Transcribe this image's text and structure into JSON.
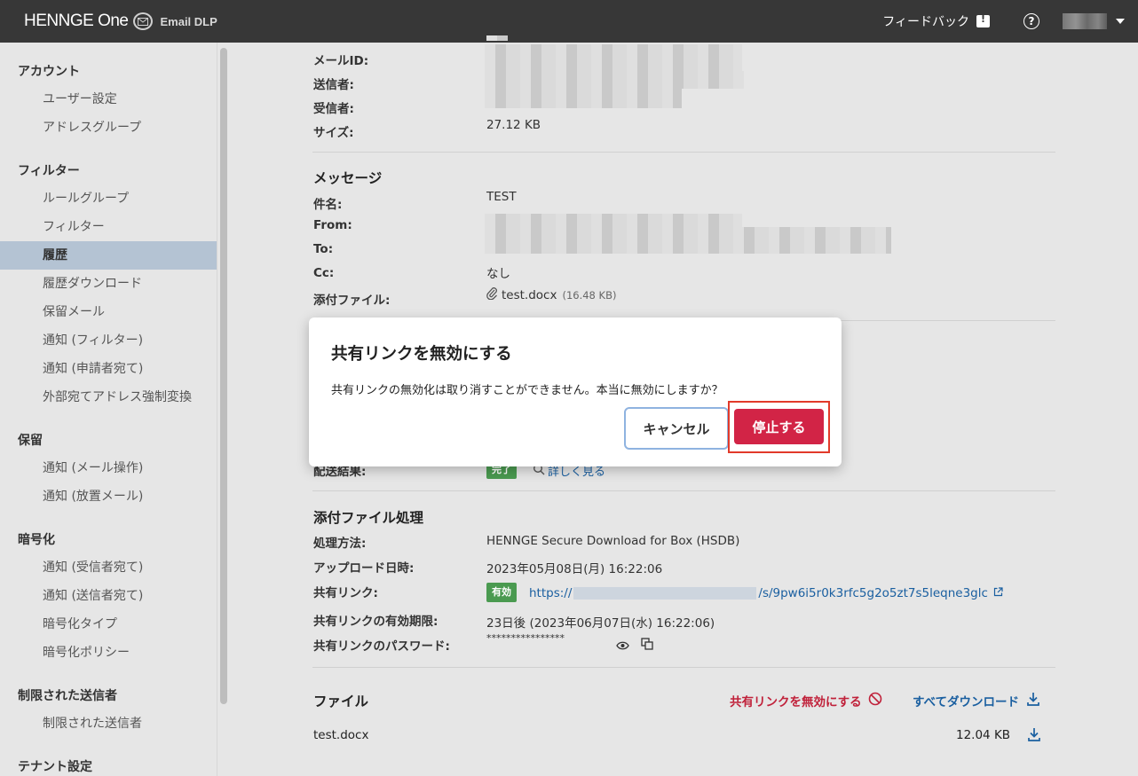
{
  "header": {
    "brand_name": "HENNGE One",
    "product": "Email DLP",
    "feedback_label": "フィードバック",
    "help_label": "?"
  },
  "sidebar": {
    "sections": [
      {
        "title": "アカウント",
        "items": [
          "ユーザー設定",
          "アドレスグループ"
        ]
      },
      {
        "title": "フィルター",
        "items": [
          "ルールグループ",
          "フィルター",
          "履歴",
          "履歴ダウンロード",
          "保留メール",
          "通知 (フィルター)",
          "通知 (申請者宛て)",
          "外部宛てアドレス強制変換"
        ]
      },
      {
        "title": "保留",
        "items": [
          "通知 (メール操作)",
          "通知 (放置メール)"
        ]
      },
      {
        "title": "暗号化",
        "items": [
          "通知 (受信者宛て)",
          "通知 (送信者宛て)",
          "暗号化タイプ",
          "暗号化ポリシー"
        ]
      },
      {
        "title": "制限された送信者",
        "items": [
          "制限された送信者"
        ]
      },
      {
        "title": "テナント設定",
        "items": []
      }
    ],
    "active_item": "履歴"
  },
  "mail_info": {
    "mail_id_label": "メールID:",
    "sender_label": "送信者:",
    "recipient_label": "受信者:",
    "size_label": "サイズ:",
    "size_value": "27.12 KB"
  },
  "message": {
    "title": "メッセージ",
    "subject_label": "件名:",
    "subject_value": "TEST",
    "from_label": "From:",
    "to_label": "To:",
    "cc_label": "Cc:",
    "cc_value": "なし",
    "attachment_label": "添付ファイル:",
    "attachment_name": "test.docx",
    "attachment_size": "(16.48 KB)"
  },
  "delivery": {
    "result_label": "配送結果:",
    "result_badge": "完了",
    "details_link": "詳しく見る"
  },
  "attachment_processing": {
    "title": "添付ファイル処理",
    "method_label": "処理方法:",
    "method_value": "HENNGE Secure Download for Box (HSDB)",
    "upload_label": "アップロード日時:",
    "upload_value": "2023年05月08日(月) 16:22:06",
    "share_link_label": "共有リンク:",
    "share_link_badge": "有効",
    "share_link_prefix": "https://",
    "share_link_suffix": "/s/9pw6i5r0k3rfc5g2o5zt7s5leqne3glc",
    "expiry_label": "共有リンクの有効期限:",
    "expiry_value": "23日後 (2023年06月07日(水) 16:22:06)",
    "password_label": "共有リンクのパスワード:",
    "password_value": "****************"
  },
  "files": {
    "title": "ファイル",
    "disable_link": "共有リンクを無効にする",
    "download_all": "すべてダウンロード",
    "rows": [
      {
        "name": "test.docx",
        "size": "12.04 KB"
      }
    ]
  },
  "modal": {
    "title": "共有リンクを無効にする",
    "message": "共有リンクの無効化は取り消すことができません。本当に無効にしますか？",
    "cancel_label": "キャンセル",
    "confirm_label": "停止する"
  },
  "colors": {
    "topbar": "#373737",
    "active_sidebar": "#b4c3d3",
    "confirm_button": "#d22446",
    "highlight_border": "#e23a2a",
    "badge_green": "#4a9a50",
    "link_blue": "#1a5fa0"
  }
}
